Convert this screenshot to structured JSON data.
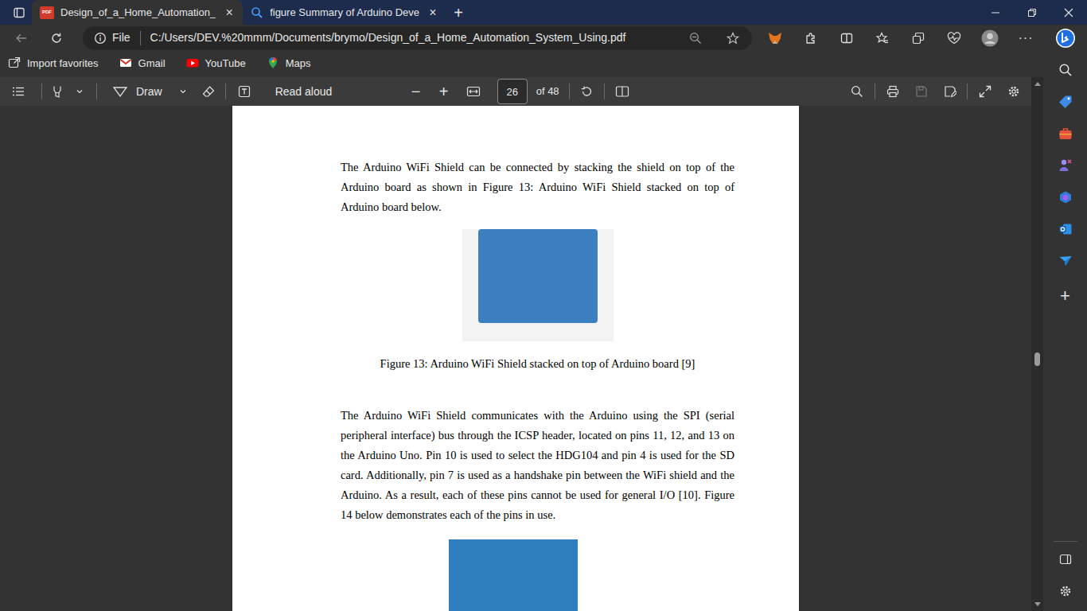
{
  "browser": {
    "tabs": [
      {
        "badge": "PDF",
        "label": "Design_of_a_Home_Automation_",
        "close": "×",
        "selected": true
      },
      {
        "label": "figure Summary of Arduino Deve",
        "close": "×",
        "selected": false
      }
    ],
    "new_tab": "+",
    "address": {
      "scheme": "File",
      "url": "C:/Users/DEV.%20mmm/Documents/brymo/Design_of_a_Home_Automation_System_Using.pdf"
    },
    "more": "···",
    "favorites": [
      {
        "label": "Import favorites"
      },
      {
        "label": "Gmail"
      },
      {
        "label": "YouTube"
      },
      {
        "label": "Maps"
      }
    ]
  },
  "pdf_toolbar": {
    "draw": "Draw",
    "read_aloud": "Read aloud",
    "zoom_out": "−",
    "zoom_in": "+",
    "page": "26",
    "page_count": "of 48"
  },
  "viewer": {
    "scroll_level": 0.53
  },
  "document": {
    "paragraphs": [
      "The Arduino WiFi Shield can be connected by stacking the shield on top of the Arduino board as shown in Figure 13: Arduino WiFi Shield stacked on top of Arduino board below.",
      "The Arduino WiFi Shield communicates with the Arduino using the SPI (serial peripheral interface) bus through the ICSP header, located on pins 11, 12, and 13 on the Arduino Uno. Pin 10 is used to select the HDG104 and pin 4 is used for the SD card. Additionally, pin 7 is used as a handshake pin between the WiFi shield and the Arduino. As a result, each of these pins cannot be used for general I/O [10]. Figure 14 below demonstrates each of the pins in use."
    ],
    "figure_caption": "Figure 13: Arduino WiFi Shield stacked on top of Arduino board [9]"
  },
  "sidebar": {
    "add": "+"
  }
}
